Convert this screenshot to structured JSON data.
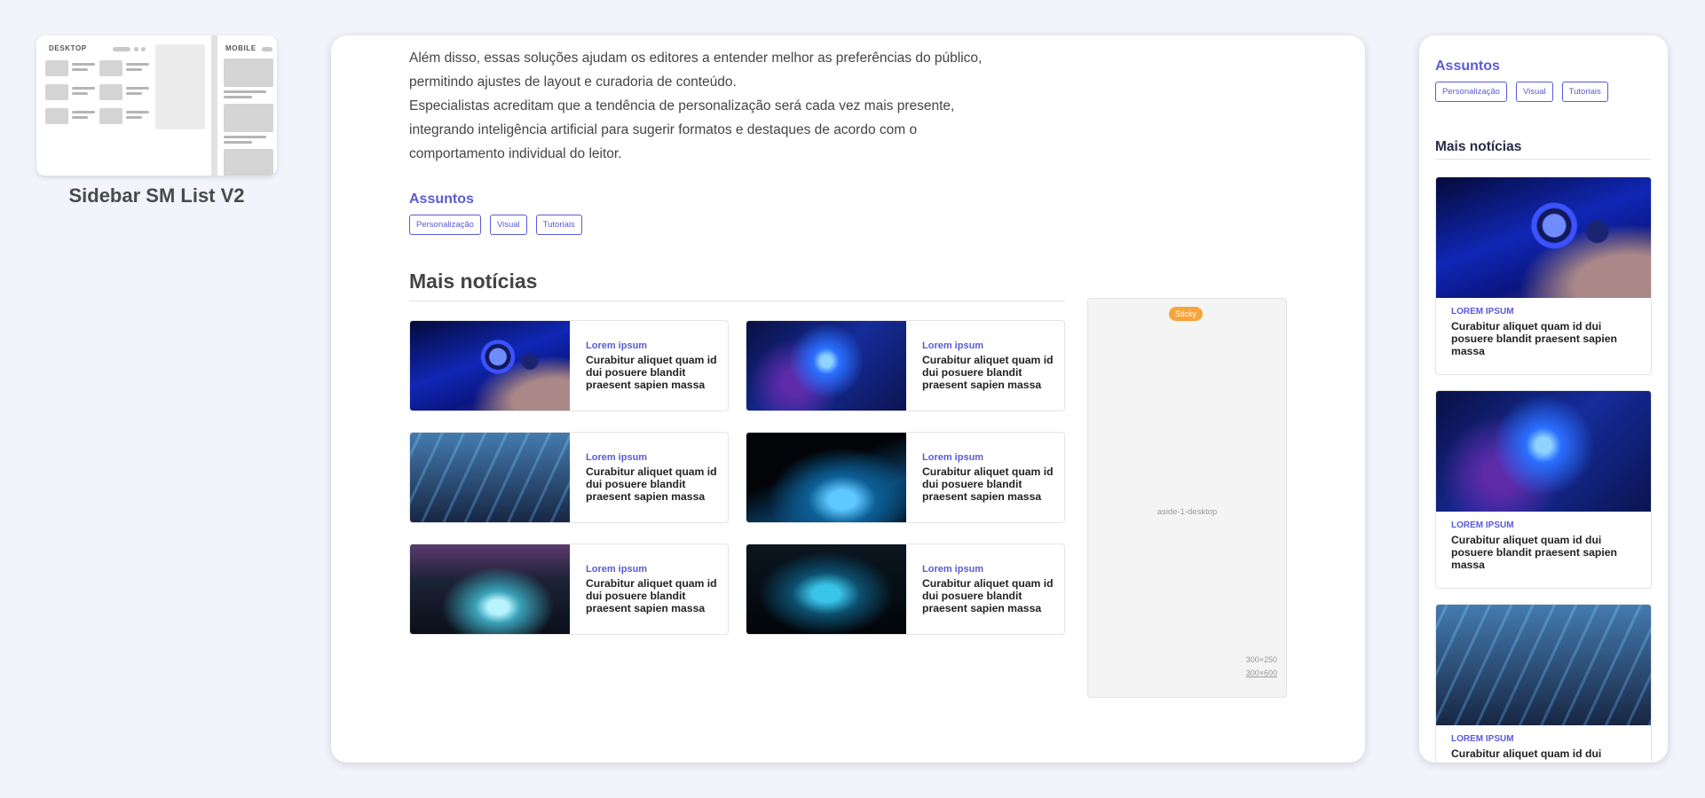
{
  "thumbnail": {
    "desktop_label": "DESKTOP",
    "mobile_label": "MOBILE",
    "title": "Sidebar SM List V2"
  },
  "article": {
    "paragraph_1": " Além disso, essas soluções ajudam os editores a entender melhor as preferências do público, permitindo ajustes de layout e curadoria de conteúdo.",
    "paragraph_2": "Especialistas acreditam que a tendência de personalização será cada vez mais presente, integrando inteligência artificial para sugerir formatos e destaques de acordo com o comportamento individual do leitor."
  },
  "topics": {
    "title": "Assuntos",
    "tags": [
      "Personalização",
      "Visual",
      "Tutoriais"
    ]
  },
  "more_news": {
    "title": "Mais notícias",
    "items": [
      {
        "category": "Lorem ipsum",
        "title": "Curabitur aliquet quam id dui posuere blandit praesent sapien massa",
        "image": "camera-lens"
      },
      {
        "category": "Lorem ipsum",
        "title": "Curabitur aliquet quam id dui posuere blandit praesent sapien massa",
        "image": "fiber-optics"
      },
      {
        "category": "Lorem ipsum",
        "title": "Curabitur aliquet quam id dui posuere blandit praesent sapien massa",
        "image": "audio-mixer"
      },
      {
        "category": "Lorem ipsum",
        "title": "Curabitur aliquet quam id dui posuere blandit praesent sapien massa",
        "image": "laptop-keyboard"
      },
      {
        "category": "Lorem ipsum",
        "title": "Curabitur aliquet quam id dui posuere blandit praesent sapien massa",
        "image": "light-hall"
      },
      {
        "category": "Lorem ipsum",
        "title": "Curabitur aliquet quam id dui posuere blandit praesent sapien massa",
        "image": "server-room"
      }
    ]
  },
  "aside": {
    "sticky_badge": "Sticky",
    "label": "aside-1-desktop",
    "size_1": "300×250",
    "size_2": "300×600"
  },
  "mobile": {
    "topics_title": "Assuntos",
    "more_news_title": "Mais notícias",
    "items": [
      {
        "category": "LOREM IPSUM",
        "title": "Curabitur aliquet quam id dui posuere blandit praesent sapien massa",
        "image": "camera-lens"
      },
      {
        "category": "LOREM IPSUM",
        "title": "Curabitur aliquet quam id dui posuere blandit praesent sapien massa",
        "image": "fiber-optics"
      },
      {
        "category": "LOREM IPSUM",
        "title": "Curabitur aliquet quam id dui",
        "image": "audio-mixer"
      }
    ]
  },
  "colors": {
    "accent": "#5a5bd6",
    "sticky": "#f6a43c",
    "background": "#f2f3fb"
  }
}
